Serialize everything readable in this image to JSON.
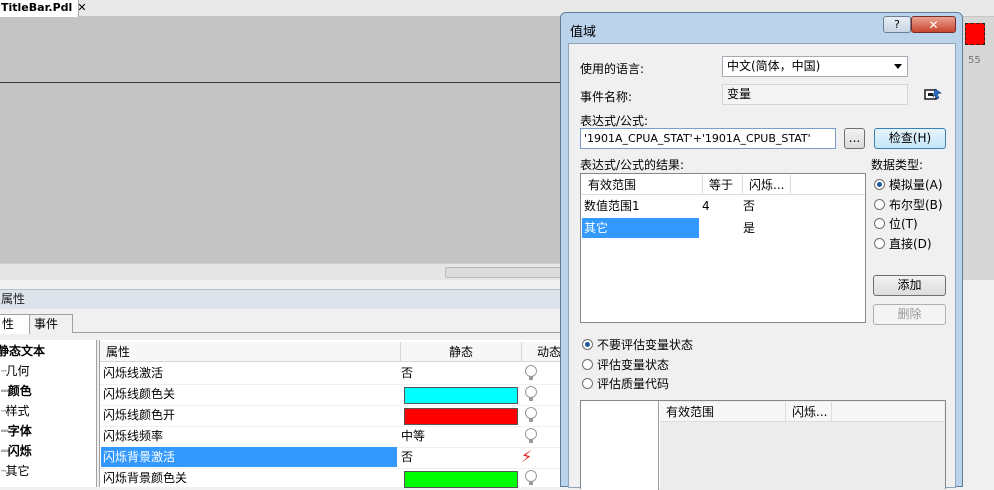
{
  "doc_tab": {
    "title": "TitleBar.Pdl",
    "close": "✕"
  },
  "side_strip": {
    "text": "55"
  },
  "properties": {
    "panel_title": "属性",
    "tabs": [
      "性",
      "事件"
    ],
    "tree": [
      "静态文本",
      "几何",
      "颜色",
      "样式",
      "字体",
      "闪烁",
      "其它"
    ],
    "columns": {
      "name": "属性",
      "static": "静态",
      "dynamic": "动态"
    },
    "rows": [
      {
        "name": "闪烁线激活",
        "value": "否",
        "color": null,
        "dynamic": "bulb"
      },
      {
        "name": "闪烁线颜色关",
        "value": "",
        "color": "#00ffff",
        "dynamic": "bulb"
      },
      {
        "name": "闪烁线颜色开",
        "value": "",
        "color": "#ff0000",
        "dynamic": "bulb"
      },
      {
        "name": "闪烁线频率",
        "value": "中等",
        "color": null,
        "dynamic": "bulb"
      },
      {
        "name": "闪烁背景激活",
        "value": "否",
        "color": null,
        "dynamic": "bolt",
        "selected": true
      },
      {
        "name": "闪烁背景颜色关",
        "value": "",
        "color": "#00ff00",
        "dynamic": "bulb"
      }
    ]
  },
  "dialog": {
    "title": "值域",
    "help": "?",
    "close": "✕",
    "language_label": "使用的语言:",
    "language_value": "中文(简体，中国)",
    "event_label": "事件名称:",
    "event_value": "变量",
    "expr_label": "表达式/公式:",
    "expr_value": "'1901A_CPUA_STAT'+'1901A_CPUB_STAT'",
    "browse": "...",
    "check": "检查(H)",
    "result_label": "表达式/公式的结果:",
    "result_columns": [
      "有效范围",
      "等于",
      "闪烁..."
    ],
    "result_rows": [
      {
        "range": "数值范围1",
        "equals": "4",
        "flash": "否"
      },
      {
        "range": "其它",
        "equals": "",
        "flash": "是"
      }
    ],
    "datatype_label": "数据类型:",
    "datatypes": [
      {
        "label": "模拟量(A)",
        "checked": true
      },
      {
        "label": "布尔型(B)",
        "checked": false
      },
      {
        "label": "位(T)",
        "checked": false
      },
      {
        "label": "直接(D)",
        "checked": false
      }
    ],
    "add": "添加",
    "delete": "删除",
    "eval_options": [
      {
        "label": "不要评估变量状态",
        "checked": true
      },
      {
        "label": "评估变量状态",
        "checked": false
      },
      {
        "label": "评估质量代码",
        "checked": false
      }
    ],
    "bottom_columns": [
      "有效范围",
      "闪烁..."
    ]
  },
  "colors": {
    "accent": "#3399ff",
    "close_red": "#c7452d"
  }
}
